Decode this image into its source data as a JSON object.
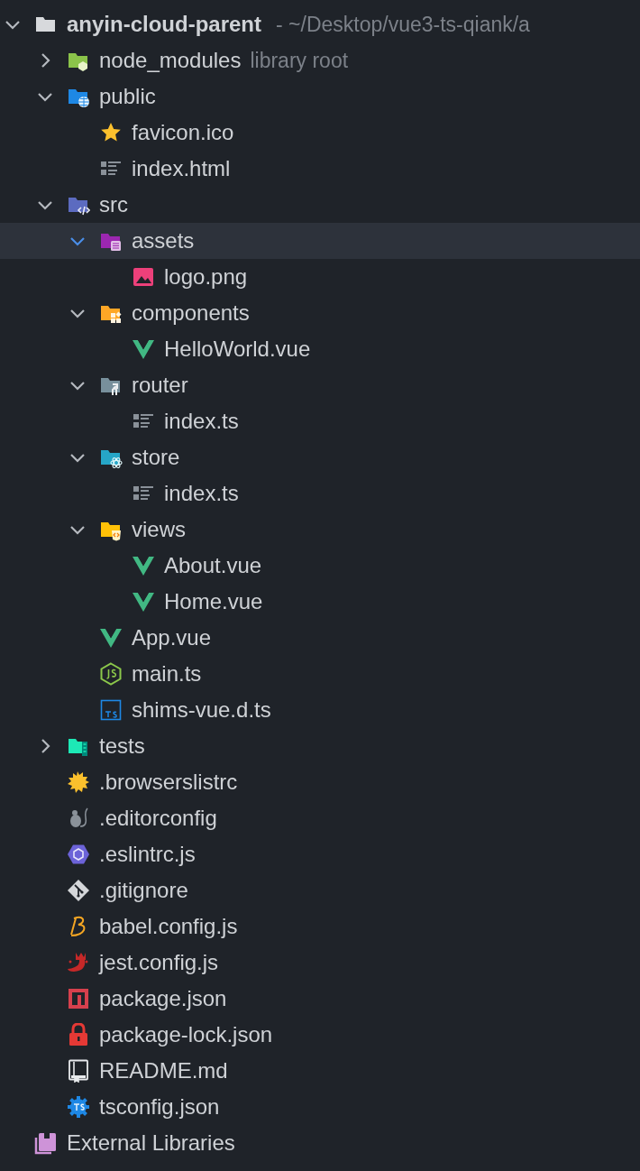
{
  "tree": [
    {
      "name": "anyin-cloud-parent",
      "hint": "- ~/Desktop/vue3-ts-qiank/a",
      "kind": "folder",
      "expanded": true,
      "selected": false,
      "children": [
        {
          "name": "node_modules",
          "hint": "library root",
          "kind": "module-folder",
          "expanded": false,
          "selected": false
        },
        {
          "name": "public",
          "kind": "web-folder",
          "expanded": true,
          "selected": false,
          "children": [
            {
              "name": "favicon.ico",
              "kind": "star",
              "selected": false
            },
            {
              "name": "index.html",
              "kind": "text",
              "selected": false
            }
          ]
        },
        {
          "name": "src",
          "kind": "source-folder",
          "expanded": true,
          "selected": false,
          "children": [
            {
              "name": "assets",
              "kind": "resource-folder",
              "expanded": true,
              "selected": true,
              "children": [
                {
                  "name": "logo.png",
                  "kind": "image",
                  "selected": false
                }
              ]
            },
            {
              "name": "components",
              "kind": "component-folder",
              "expanded": true,
              "selected": false,
              "children": [
                {
                  "name": "HelloWorld.vue",
                  "kind": "vue",
                  "selected": false
                }
              ]
            },
            {
              "name": "router",
              "kind": "router-folder",
              "expanded": true,
              "selected": false,
              "children": [
                {
                  "name": "index.ts",
                  "kind": "text",
                  "selected": false
                }
              ]
            },
            {
              "name": "store",
              "kind": "store-folder",
              "expanded": true,
              "selected": false,
              "children": [
                {
                  "name": "index.ts",
                  "kind": "text",
                  "selected": false
                }
              ]
            },
            {
              "name": "views",
              "kind": "views-folder",
              "expanded": true,
              "selected": false,
              "children": [
                {
                  "name": "About.vue",
                  "kind": "vue",
                  "selected": false
                },
                {
                  "name": "Home.vue",
                  "kind": "vue",
                  "selected": false
                }
              ]
            },
            {
              "name": "App.vue",
              "kind": "vue",
              "selected": false
            },
            {
              "name": "main.ts",
              "kind": "js",
              "selected": false
            },
            {
              "name": "shims-vue.d.ts",
              "kind": "ts",
              "selected": false
            }
          ]
        },
        {
          "name": "tests",
          "kind": "test-folder",
          "expanded": false,
          "selected": false
        },
        {
          "name": ".browserslistrc",
          "kind": "burst",
          "selected": false
        },
        {
          "name": ".editorconfig",
          "kind": "mouse",
          "selected": false
        },
        {
          "name": ".eslintrc.js",
          "kind": "hexagon",
          "selected": false
        },
        {
          "name": ".gitignore",
          "kind": "git",
          "selected": false
        },
        {
          "name": "babel.config.js",
          "kind": "babel",
          "selected": false
        },
        {
          "name": "jest.config.js",
          "kind": "jest",
          "selected": false
        },
        {
          "name": "package.json",
          "kind": "npm",
          "selected": false
        },
        {
          "name": "package-lock.json",
          "kind": "lock",
          "selected": false
        },
        {
          "name": "README.md",
          "kind": "book",
          "selected": false
        },
        {
          "name": "tsconfig.json",
          "kind": "tsconfig",
          "selected": false
        }
      ]
    },
    {
      "name": "External Libraries",
      "kind": "library",
      "selected": false
    }
  ]
}
